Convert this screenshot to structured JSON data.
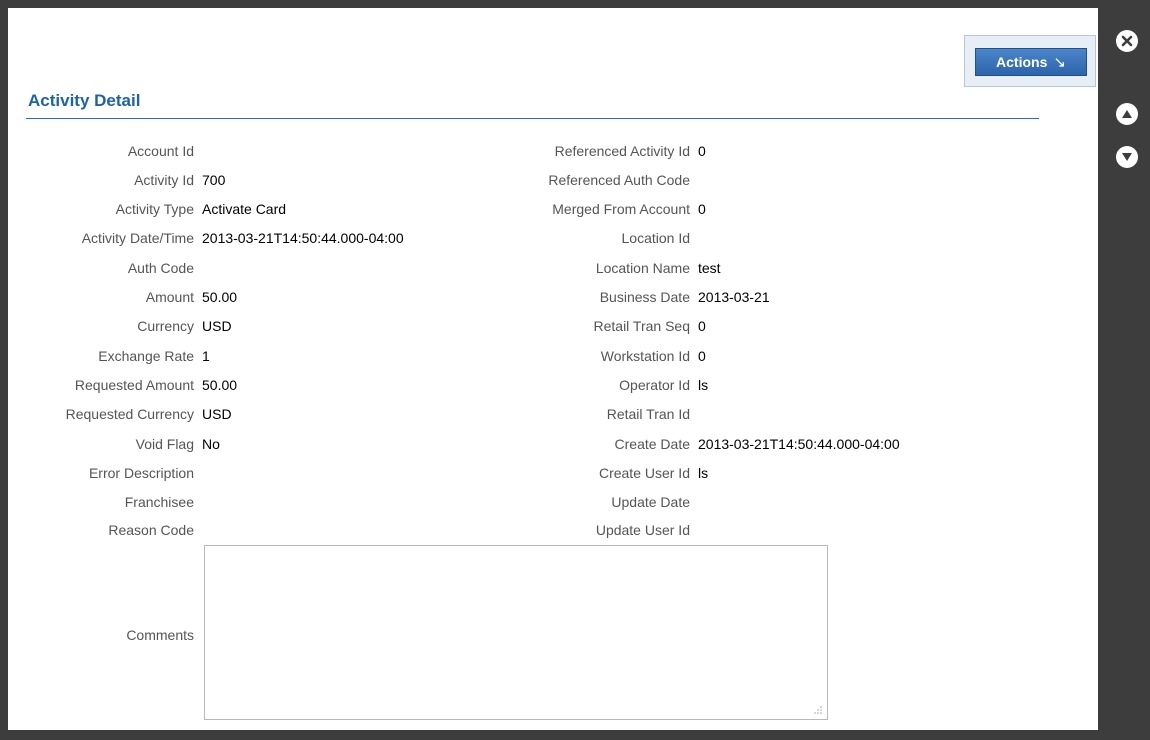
{
  "header": {
    "actions_label": "Actions",
    "actions_arrow": "↘"
  },
  "title": "Activity Detail",
  "left_fields": [
    {
      "label": "Account Id",
      "value": ""
    },
    {
      "label": "Activity Id",
      "value": "700"
    },
    {
      "label": "Activity Type",
      "value": "Activate Card"
    },
    {
      "label": "Activity Date/Time",
      "value": "2013-03-21T14:50:44.000-04:00"
    },
    {
      "label": "Auth Code",
      "value": ""
    },
    {
      "label": "Amount",
      "value": "50.00"
    },
    {
      "label": "Currency",
      "value": "USD"
    },
    {
      "label": "Exchange Rate",
      "value": "1"
    },
    {
      "label": "Requested Amount",
      "value": "50.00"
    },
    {
      "label": "Requested Currency",
      "value": "USD"
    },
    {
      "label": "Void Flag",
      "value": "No"
    },
    {
      "label": "Error Description",
      "value": ""
    },
    {
      "label": "Franchisee",
      "value": ""
    },
    {
      "label": "Reason Code",
      "value": ""
    }
  ],
  "right_fields": [
    {
      "label": "Referenced Activity Id",
      "value": "0"
    },
    {
      "label": "Referenced Auth Code",
      "value": ""
    },
    {
      "label": "Merged From Account",
      "value": "0"
    },
    {
      "label": "Location Id",
      "value": ""
    },
    {
      "label": "Location Name",
      "value": "test"
    },
    {
      "label": "Business Date",
      "value": "2013-03-21"
    },
    {
      "label": "Retail Tran Seq",
      "value": "0"
    },
    {
      "label": "Workstation Id",
      "value": "0"
    },
    {
      "label": "Operator Id",
      "value": "ls"
    },
    {
      "label": "Retail Tran Id",
      "value": ""
    },
    {
      "label": "Create Date",
      "value": "2013-03-21T14:50:44.000-04:00"
    },
    {
      "label": "Create User Id",
      "value": "ls"
    },
    {
      "label": "Update Date",
      "value": ""
    },
    {
      "label": "Update User Id",
      "value": ""
    }
  ],
  "comments": {
    "label": "Comments",
    "value": ""
  },
  "side_controls": {
    "close_icon": "close-circle-icon",
    "up_icon": "arrow-up-circle-icon",
    "down_icon": "arrow-down-circle-icon"
  },
  "colors": {
    "accent": "#1d62ae",
    "frame": "#3d3d3d"
  }
}
